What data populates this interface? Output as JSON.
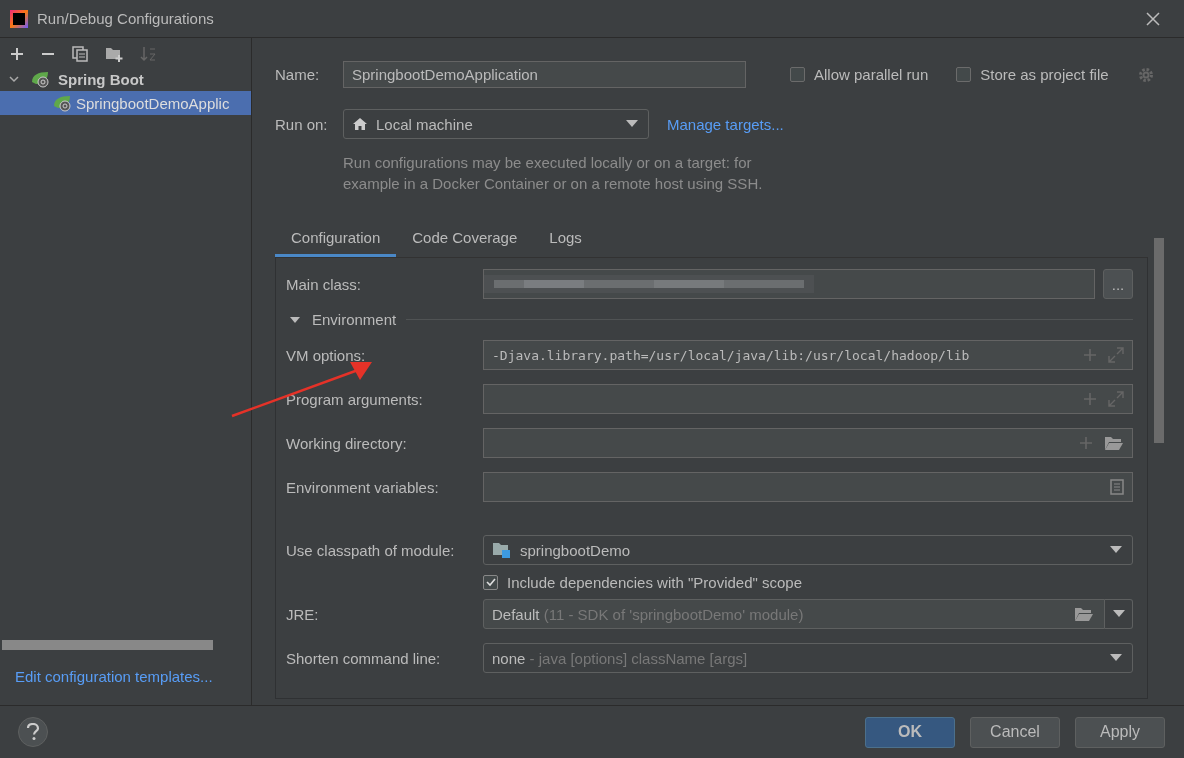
{
  "window": {
    "title": "Run/Debug Configurations"
  },
  "tree": [
    {
      "label": "Spring Boot",
      "expanded": true,
      "selected": false,
      "children": [
        {
          "label": "SpringbootDemoApplic",
          "selected": true
        }
      ]
    }
  ],
  "templates_link": "Edit configuration templates...",
  "name": {
    "label": "Name:",
    "value": "SpringbootDemoApplication"
  },
  "options": [
    {
      "label": "Allow parallel run",
      "checked": false
    },
    {
      "label": "Store as project file",
      "checked": false
    }
  ],
  "run_on": {
    "label": "Run on:",
    "value": "Local machine",
    "link": "Manage targets..."
  },
  "hint": "Run configurations may be executed locally or on a target: for example in a Docker Container or on a remote host using SSH.",
  "tabs": [
    {
      "label": "Configuration",
      "selected": true
    },
    {
      "label": "Code Coverage",
      "selected": false
    },
    {
      "label": "Logs",
      "selected": false
    }
  ],
  "main_class": {
    "label": "Main class:",
    "button": "..."
  },
  "section": {
    "label": "Environment",
    "expanded": true
  },
  "fields": [
    {
      "kind": "expandable",
      "label": "VM options:",
      "value": "-Djava.library.path=/usr/local/java/lib:/usr/local/hadoop/lib"
    },
    {
      "kind": "expandable",
      "label": "Program arguments:"
    },
    {
      "kind": "directory",
      "label": "Working directory:"
    },
    {
      "kind": "variables",
      "label": "Environment variables:"
    }
  ],
  "module": {
    "label": "Use classpath of module:",
    "value": "springbootDemo"
  },
  "include_provided": {
    "label": "Include dependencies with \"Provided\" scope",
    "checked": true
  },
  "jre": {
    "label": "JRE:",
    "value": "Default",
    "detail": "(11 - SDK of 'springbootDemo' module)"
  },
  "shorten": {
    "label": "Shorten command line:",
    "value": "none",
    "detail": "- java [options] className [args]"
  },
  "buttons": [
    {
      "label": "OK",
      "primary": true
    },
    {
      "label": "Cancel",
      "primary": false
    },
    {
      "label": "Apply",
      "primary": false
    }
  ]
}
